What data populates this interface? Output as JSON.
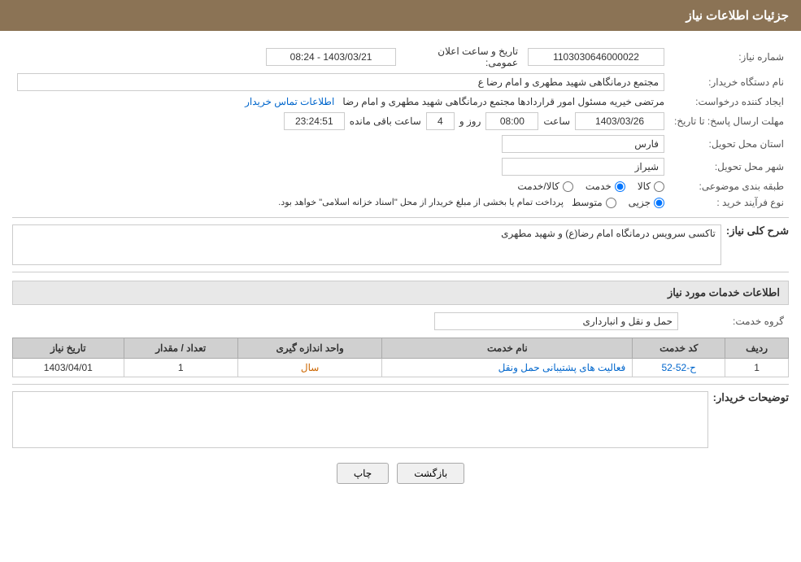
{
  "header": {
    "title": "جزئیات اطلاعات نیاز"
  },
  "fields": {
    "need_number_label": "شماره نیاز:",
    "need_number_value": "1103030646000022",
    "announce_datetime_label": "تاریخ و ساعت اعلان عمومی:",
    "announce_datetime_value": "1403/03/21 - 08:24",
    "buyer_org_label": "نام دستگاه خریدار:",
    "buyer_org_value": "مجتمع درمانگاهی شهید مطهری و امام رضا ع",
    "creator_label": "ایجاد کننده درخواست:",
    "creator_value": "مرتضی خیریه مسئول امور قراردادها مجتمع درمانگاهی شهید مطهری و امام رضا",
    "creator_link": "اطلاعات تماس خریدار",
    "response_deadline_label": "مهلت ارسال پاسخ: تا تاریخ:",
    "response_date": "1403/03/26",
    "response_time_label": "ساعت",
    "response_time": "08:00",
    "response_days_label": "روز و",
    "response_days": "4",
    "response_remaining_label": "ساعت باقی مانده",
    "response_remaining": "23:24:51",
    "province_label": "استان محل تحویل:",
    "province_value": "فارس",
    "city_label": "شهر محل تحویل:",
    "city_value": "شیراز",
    "category_label": "طبقه بندی موضوعی:",
    "category_options": [
      {
        "label": "کالا",
        "value": "goods"
      },
      {
        "label": "خدمت",
        "value": "service"
      },
      {
        "label": "کالا/خدمت",
        "value": "both"
      }
    ],
    "category_selected": "service",
    "purchase_type_label": "نوع فرآیند خرید :",
    "purchase_type_options": [
      {
        "label": "جزیی",
        "value": "partial"
      },
      {
        "label": "متوسط",
        "value": "medium"
      }
    ],
    "purchase_type_selected": "partial",
    "purchase_type_note": "پرداخت تمام یا بخشی از مبلغ خریدار از محل \"اسناد خزانه اسلامی\" خواهد بود.",
    "description_label": "شرح کلی نیاز:",
    "description_value": "تاکسی سرویس درمانگاه امام رضا(ع) و شهید مطهری",
    "services_section_label": "اطلاعات خدمات مورد نیاز",
    "service_group_label": "گروه خدمت:",
    "service_group_value": "حمل و نقل و انبارداری",
    "table_headers": {
      "row": "ردیف",
      "code": "کد خدمت",
      "name": "نام خدمت",
      "unit": "واحد اندازه گیری",
      "quantity": "تعداد / مقدار",
      "date": "تاریخ نیاز"
    },
    "table_rows": [
      {
        "row": "1",
        "code": "ح-52-52",
        "name": "فعالیت های پشتیبانی حمل ونقل",
        "unit": "سال",
        "quantity": "1",
        "date": "1403/04/01"
      }
    ],
    "buyer_notes_label": "توضیحات خریدار:",
    "buyer_notes_value": ""
  },
  "buttons": {
    "print": "چاپ",
    "back": "بازگشت"
  }
}
